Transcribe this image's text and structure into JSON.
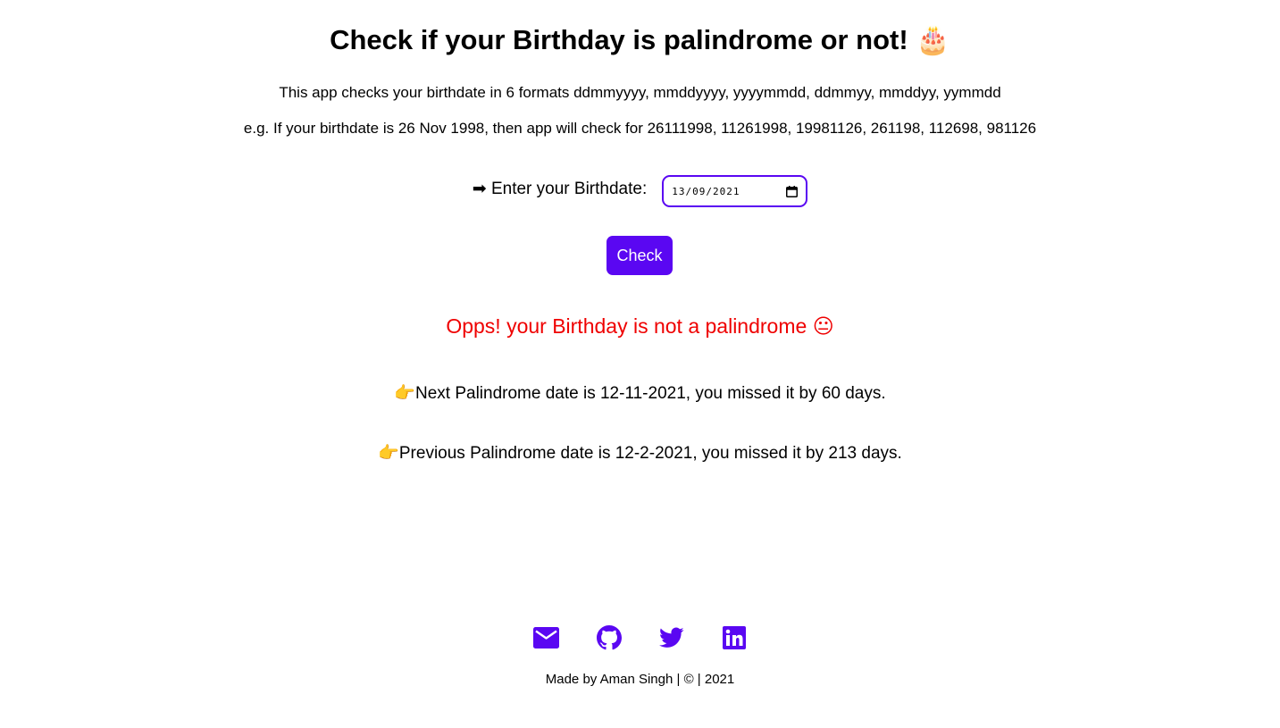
{
  "header": {
    "title": "Check if your Birthday is palindrome or not!",
    "title_emoji": "🎂"
  },
  "description": {
    "line1": "This app checks your birthdate in 6 formats ddmmyyyy, mmddyyyy, yyyymmdd, ddmmyy, mmddyy, yymmdd",
    "line2": "e.g. If your birthdate is 26 Nov 1998, then app will check for 26111998, 11261998, 19981126, 261198, 112698, 981126"
  },
  "form": {
    "label_arrow": "➡",
    "label": "Enter your Birthdate:",
    "date_value": "13/09/2021",
    "check_label": "Check"
  },
  "result": {
    "message": "Opps! your Birthday is not a palindrome",
    "emoji": "😐"
  },
  "info": {
    "pointer": "👉",
    "next": "Next Palindrome date is 12-11-2021, you missed it by 60 days.",
    "previous": "Previous Palindrome date is 12-2-2021, you missed it by 213 days."
  },
  "social": {
    "icons": [
      "mail-icon",
      "github-icon",
      "twitter-icon",
      "linkedin-icon"
    ]
  },
  "footer": {
    "text": "Made by Aman Singh | © | 2021"
  },
  "colors": {
    "accent": "#5a07f2",
    "error": "#ef0000"
  }
}
